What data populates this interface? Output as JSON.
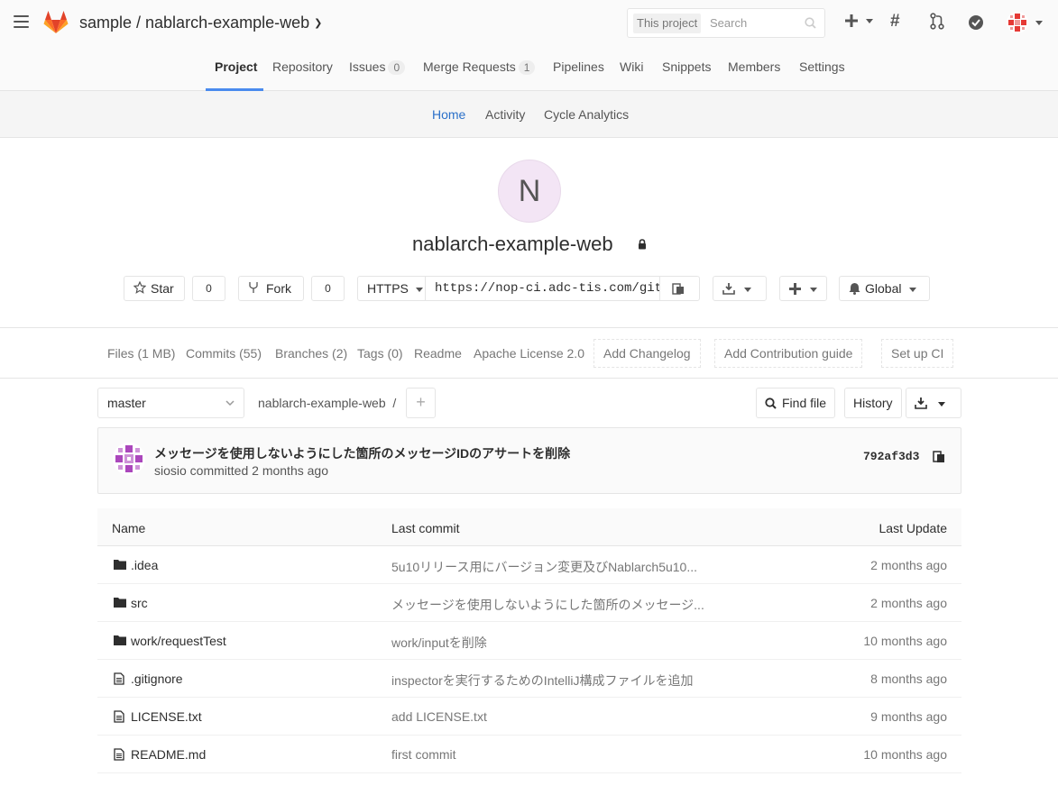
{
  "header": {
    "project_path": "sample / nablarch-example-web",
    "search_scope": "This project",
    "search_placeholder": "Search"
  },
  "main_nav": [
    {
      "label": "Project"
    },
    {
      "label": "Repository"
    },
    {
      "label": "Issues",
      "count": "0"
    },
    {
      "label": "Merge Requests",
      "count": "1"
    },
    {
      "label": "Pipelines"
    },
    {
      "label": "Wiki"
    },
    {
      "label": "Snippets"
    },
    {
      "label": "Members"
    },
    {
      "label": "Settings"
    }
  ],
  "sub_nav": [
    {
      "label": "Home"
    },
    {
      "label": "Activity"
    },
    {
      "label": "Cycle Analytics"
    }
  ],
  "project": {
    "avatar_letter": "N",
    "name": "nablarch-example-web",
    "star_label": "Star",
    "star_count": "0",
    "fork_label": "Fork",
    "fork_count": "0",
    "clone_protocol": "HTTPS",
    "clone_url": "https://nop-ci.adc-tis.com/gitlab/sample/nablarch-example-web.git",
    "notification_level": "Global"
  },
  "stats": {
    "files": "Files (1 MB)",
    "commits": "Commits (55)",
    "branches": "Branches (2)",
    "tags": "Tags (0)",
    "readme": "Readme",
    "license": "Apache License 2.0",
    "add_changelog": "Add Changelog",
    "add_contribution": "Add Contribution guide",
    "setup_ci": "Set up CI"
  },
  "tree": {
    "branch": "master",
    "path": "nablarch-example-web",
    "path_sep": "/",
    "find_file": "Find file",
    "history": "History"
  },
  "last_commit": {
    "title": "メッセージを使用しないようにした箇所のメッセージIDのアサートを削除",
    "meta": "siosio committed 2 months ago",
    "sha": "792af3d3"
  },
  "file_table": {
    "headers": [
      "Name",
      "Last commit",
      "Last Update"
    ],
    "rows": [
      {
        "type": "folder",
        "name": ".idea",
        "commit": "5u10リリース用にバージョン変更及びNablarch5u10...",
        "updated": "2 months ago"
      },
      {
        "type": "folder",
        "name": "src",
        "commit": "メッセージを使用しないようにした箇所のメッセージ...",
        "updated": "2 months ago"
      },
      {
        "type": "folder",
        "name": "work/requestTest",
        "commit": "work/inputを削除",
        "updated": "10 months ago"
      },
      {
        "type": "file",
        "name": ".gitignore",
        "commit": "inspectorを実行するためのIntelliJ構成ファイルを追加",
        "updated": "8 months ago"
      },
      {
        "type": "file",
        "name": "LICENSE.txt",
        "commit": "add LICENSE.txt",
        "updated": "9 months ago"
      },
      {
        "type": "file",
        "name": "README.md",
        "commit": "first commit",
        "updated": "10 months ago"
      }
    ]
  },
  "colors": {
    "accent": "#4a8bee",
    "active_link": "#2b70c9",
    "logo_orange": "#fc6d26"
  }
}
